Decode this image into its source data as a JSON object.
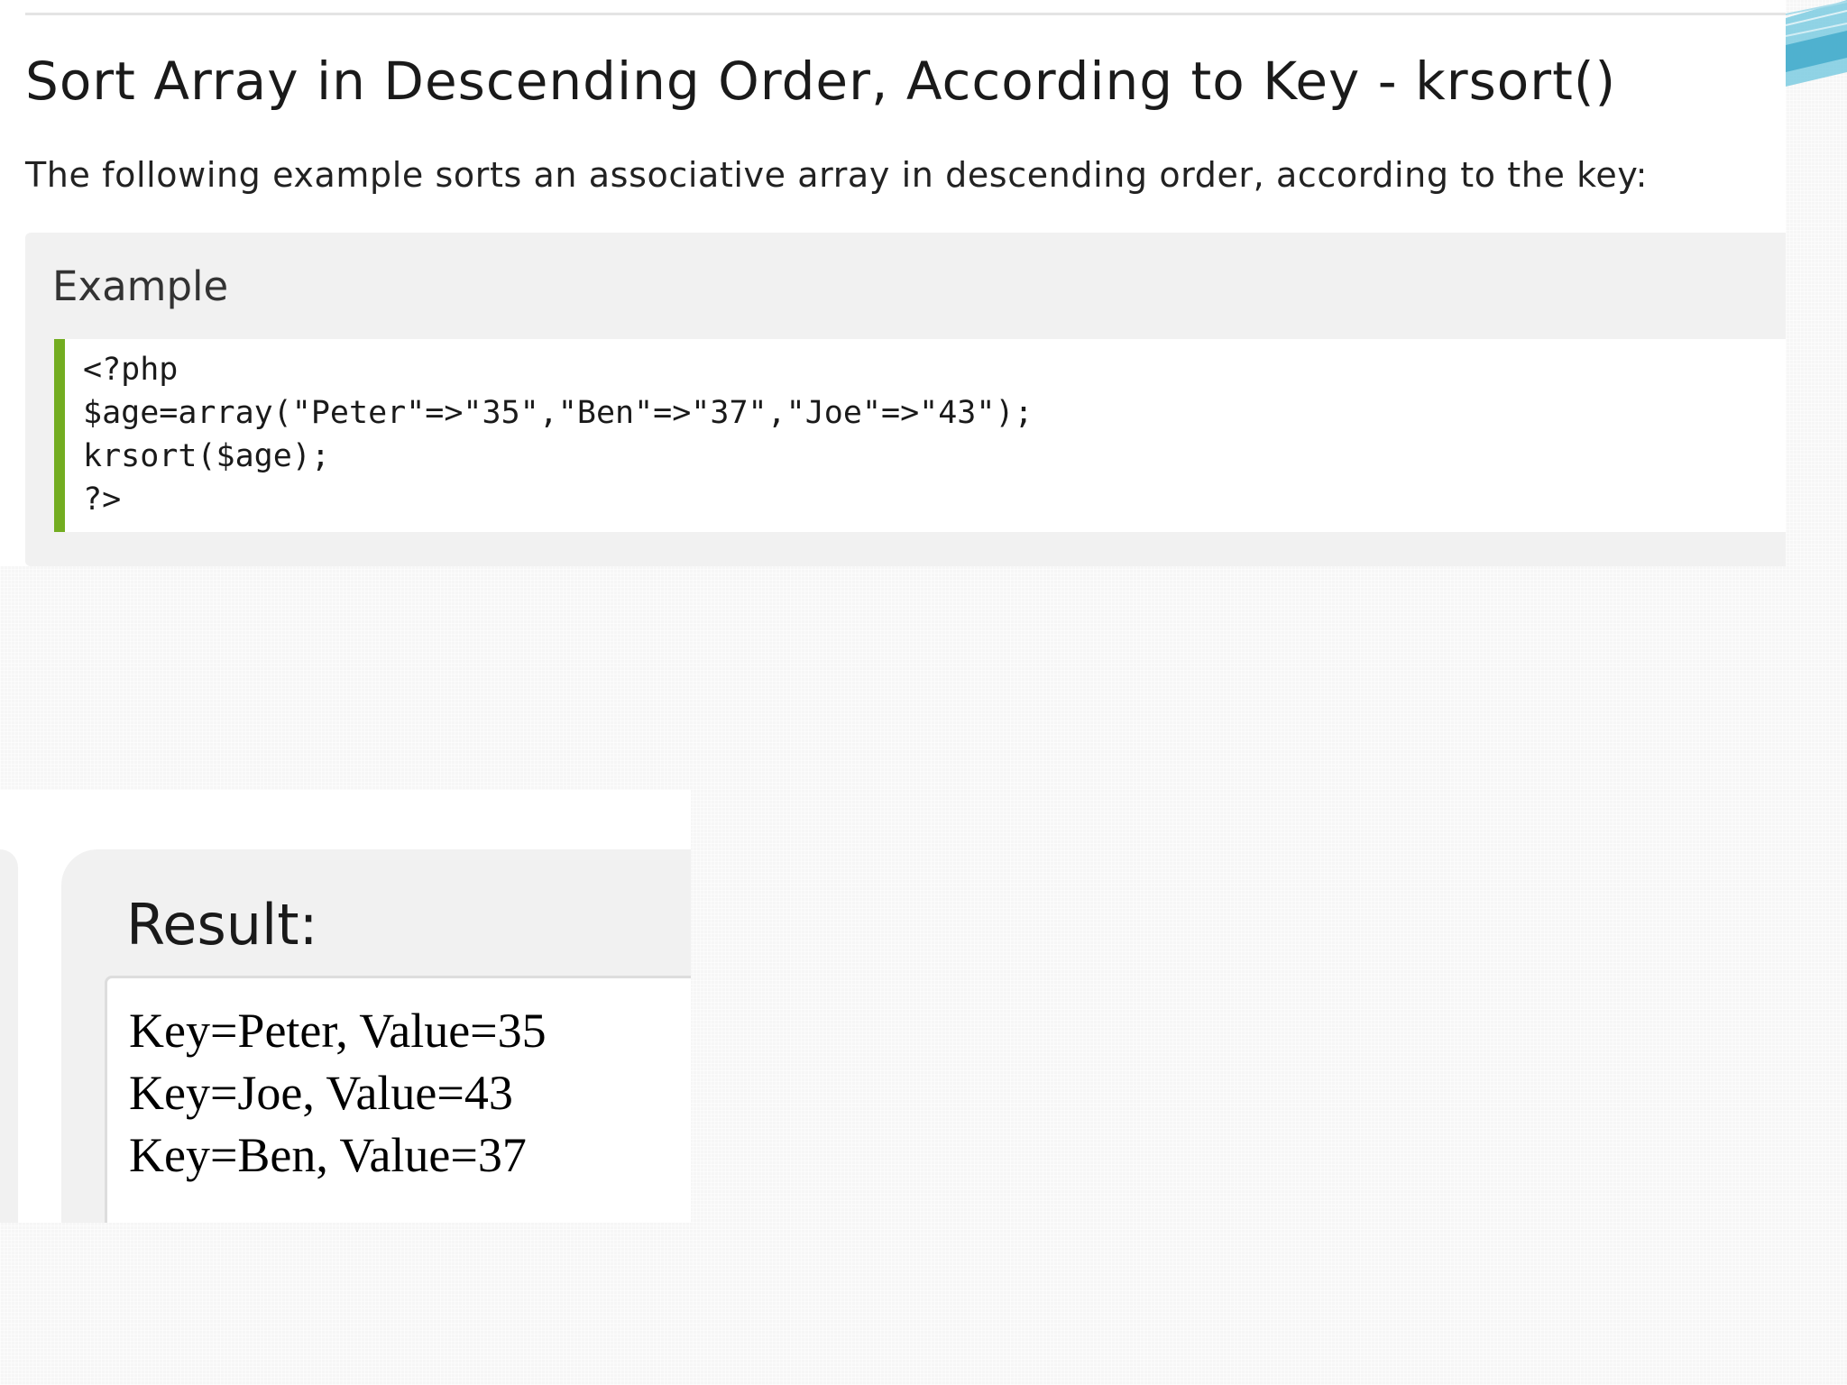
{
  "tutorial": {
    "heading": "Sort Array in Descending Order, According to Key - krsort()",
    "intro": "The following example sorts an associative array in descending order, according to the key:",
    "example": {
      "title": "Example",
      "code_lines": [
        "<?php",
        "$age=array(\"Peter\"=>\"35\",\"Ben\"=>\"37\",\"Joe\"=>\"43\");",
        "krsort($age);",
        "?>"
      ]
    }
  },
  "result": {
    "title": "Result:",
    "lines": [
      "Key=Peter, Value=35",
      "Key=Joe, Value=43",
      "Key=Ben, Value=37"
    ]
  },
  "colors": {
    "code_accent": "#73ad21",
    "example_bg": "#f1f1f1",
    "deco_teal": "#4fb8d4"
  }
}
